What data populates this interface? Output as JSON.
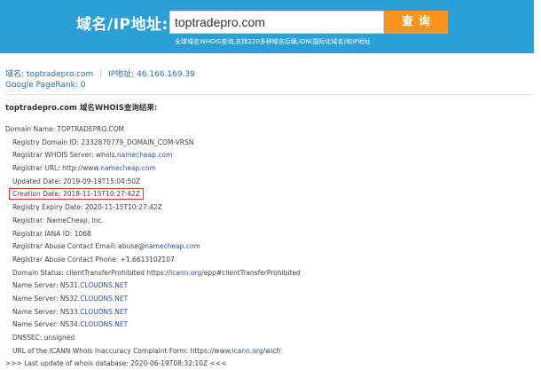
{
  "search": {
    "label": "域名/IP地址:",
    "value": "toptradepro.com",
    "button": "查询",
    "subtitle": "全球域名WHOIS查询,支持220多种域名后缀,IDN(国际化域名)和IP地址"
  },
  "info": {
    "domain_label": "域名:",
    "domain_value": "toptradepro.com",
    "ip_label": "IP地址:",
    "ip_value": "46.166.169.39",
    "pagerank": "Google PageRank: 0"
  },
  "result_title": "toptradepro.com 域名WHOIS查询结果:",
  "whois": [
    {
      "pre": "Domain Name: TOPTRADEPRO.COM",
      "link": "",
      "post": "",
      "indent": false,
      "highlight": false
    },
    {
      "pre": "Registry Domain ID: 2332870779_DOMAIN_COM-VRSN",
      "link": "",
      "post": "",
      "indent": true,
      "highlight": false
    },
    {
      "pre": "Registrar WHOIS Server: whois.",
      "link": "namecheap.com",
      "post": "",
      "indent": true,
      "highlight": false
    },
    {
      "pre": "Registrar URL: http://www.",
      "link": "namecheap.com",
      "post": "",
      "indent": true,
      "highlight": false
    },
    {
      "pre": "Updated Date: 2019-09-19T15:04:50Z",
      "link": "",
      "post": "",
      "indent": true,
      "highlight": false
    },
    {
      "pre": "Creation Date: 2018-11-15T10:27:42Z",
      "link": "",
      "post": "",
      "indent": true,
      "highlight": true
    },
    {
      "pre": "Registry Expiry Date: 2020-11-15T10:27:42Z",
      "link": "",
      "post": "",
      "indent": true,
      "highlight": false
    },
    {
      "pre": "Registrar: NameCheap, Inc.",
      "link": "",
      "post": "",
      "indent": true,
      "highlight": false
    },
    {
      "pre": "Registrar IANA ID: 1068",
      "link": "",
      "post": "",
      "indent": true,
      "highlight": false
    },
    {
      "pre": "Registrar Abuse Contact Email: abuse@",
      "link": "namecheap.com",
      "post": "",
      "indent": true,
      "highlight": false
    },
    {
      "pre": "Registrar Abuse Contact Phone: +1.6613102107",
      "link": "",
      "post": "",
      "indent": true,
      "highlight": false
    },
    {
      "pre": "Domain Status: clientTransferProhibited https://",
      "link": "icann.org",
      "post": "/epp#clientTransferProhibited",
      "indent": true,
      "highlight": false
    },
    {
      "pre": "Name Server: NS31.",
      "link": "CLOUDNS.NET",
      "post": "",
      "indent": true,
      "highlight": false
    },
    {
      "pre": "Name Server: NS32.",
      "link": "CLOUDNS.NET",
      "post": "",
      "indent": true,
      "highlight": false
    },
    {
      "pre": "Name Server: NS33.",
      "link": "CLOUDNS.NET",
      "post": "",
      "indent": true,
      "highlight": false
    },
    {
      "pre": "Name Server: NS34.",
      "link": "CLOUDNS.NET",
      "post": "",
      "indent": true,
      "highlight": false
    },
    {
      "pre": "DNSSEC: unsigned",
      "link": "",
      "post": "",
      "indent": true,
      "highlight": false
    },
    {
      "pre": "URL of the ICANN Whois Inaccuracy Complaint Form: https://www.",
      "link": "icann.org",
      "post": "/wicf/",
      "indent": true,
      "highlight": false
    },
    {
      "pre": ">>> Last update of whois database: 2020-06-19T08:32:10Z <<<",
      "link": "",
      "post": "",
      "indent": false,
      "highlight": false
    }
  ],
  "colors": {
    "banner": "#2a9fd8",
    "button": "#f7941d",
    "link": "#2c6fb5",
    "highlight_border": "#d9342b"
  }
}
